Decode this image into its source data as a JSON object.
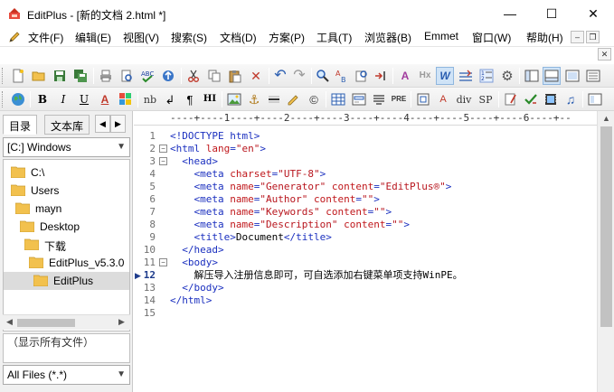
{
  "window": {
    "title": "EditPlus - [新的文档 2.html *]",
    "controls": {
      "minimize": "—",
      "maximize": "☐",
      "close": "✕"
    }
  },
  "menu": {
    "items": [
      "文件(F)",
      "编辑(E)",
      "视图(V)",
      "搜索(S)",
      "文档(D)",
      "方案(P)",
      "工具(T)",
      "浏览器(B)",
      "Emmet",
      "窗口(W)",
      "帮助(H)"
    ],
    "mdi": {
      "minimize": "–",
      "restore": "❐",
      "close": "✕"
    }
  },
  "toolbar2_labels": {
    "bold": "B",
    "italic": "I",
    "underline": "U",
    "font_color": "A",
    "nb": "nb",
    "br": "↲",
    "para": "¶",
    "hi": "HI",
    "pre": "PRE",
    "div": "div",
    "sp": "SP",
    "font_size": "A",
    "hx": "Hx",
    "w": "W",
    "abc": "abc"
  },
  "sidebar": {
    "tabs": [
      "目录",
      "文本库"
    ],
    "drive": "[C:] Windows",
    "folders": [
      {
        "label": "C:\\",
        "indent": 1,
        "selected": false
      },
      {
        "label": "Users",
        "indent": 1,
        "selected": false
      },
      {
        "label": "mayn",
        "indent": 2,
        "selected": false
      },
      {
        "label": "Desktop",
        "indent": 3,
        "selected": false
      },
      {
        "label": "下载",
        "indent": 4,
        "selected": false
      },
      {
        "label": "EditPlus_v5.3.0",
        "indent": 5,
        "selected": false
      },
      {
        "label": "EditPlus",
        "indent": 6,
        "selected": true
      }
    ],
    "file_list_text": "（显示所有文件）",
    "filter": "All Files (*.*)"
  },
  "editor": {
    "ruler": "----+----1----+----2----+----3----+----4----+----5----+----6----+--",
    "current_line": 12,
    "lines": [
      {
        "n": "1",
        "fold": "",
        "parts": [
          [
            "tag",
            "<!DOCTYPE html>"
          ]
        ]
      },
      {
        "n": "2",
        "fold": "⊟",
        "parts": [
          [
            "tag",
            "<html "
          ],
          [
            "attr",
            "lang"
          ],
          [
            "tag",
            "="
          ],
          [
            "str",
            "\"en\""
          ],
          [
            "tag",
            ">"
          ]
        ]
      },
      {
        "n": "3",
        "fold": "⊟",
        "parts": [
          [
            "txt",
            "  "
          ],
          [
            "tag",
            "<head>"
          ]
        ]
      },
      {
        "n": "4",
        "fold": "",
        "parts": [
          [
            "txt",
            "    "
          ],
          [
            "tag",
            "<meta "
          ],
          [
            "attr",
            "charset"
          ],
          [
            "tag",
            "="
          ],
          [
            "str",
            "\"UTF-8\""
          ],
          [
            "tag",
            ">"
          ]
        ]
      },
      {
        "n": "5",
        "fold": "",
        "parts": [
          [
            "txt",
            "    "
          ],
          [
            "tag",
            "<meta "
          ],
          [
            "attr",
            "name"
          ],
          [
            "tag",
            "="
          ],
          [
            "str",
            "\"Generator\""
          ],
          [
            "tag",
            " "
          ],
          [
            "attr",
            "content"
          ],
          [
            "tag",
            "="
          ],
          [
            "str",
            "\"EditPlus®\""
          ],
          [
            "tag",
            ">"
          ]
        ]
      },
      {
        "n": "6",
        "fold": "",
        "parts": [
          [
            "txt",
            "    "
          ],
          [
            "tag",
            "<meta "
          ],
          [
            "attr",
            "name"
          ],
          [
            "tag",
            "="
          ],
          [
            "str",
            "\"Author\""
          ],
          [
            "tag",
            " "
          ],
          [
            "attr",
            "content"
          ],
          [
            "tag",
            "="
          ],
          [
            "str",
            "\"\""
          ],
          [
            "tag",
            ">"
          ]
        ]
      },
      {
        "n": "7",
        "fold": "",
        "parts": [
          [
            "txt",
            "    "
          ],
          [
            "tag",
            "<meta "
          ],
          [
            "attr",
            "name"
          ],
          [
            "tag",
            "="
          ],
          [
            "str",
            "\"Keywords\""
          ],
          [
            "tag",
            " "
          ],
          [
            "attr",
            "content"
          ],
          [
            "tag",
            "="
          ],
          [
            "str",
            "\"\""
          ],
          [
            "tag",
            ">"
          ]
        ]
      },
      {
        "n": "8",
        "fold": "",
        "parts": [
          [
            "txt",
            "    "
          ],
          [
            "tag",
            "<meta "
          ],
          [
            "attr",
            "name"
          ],
          [
            "tag",
            "="
          ],
          [
            "str",
            "\"Description\""
          ],
          [
            "tag",
            " "
          ],
          [
            "attr",
            "content"
          ],
          [
            "tag",
            "="
          ],
          [
            "str",
            "\"\""
          ],
          [
            "tag",
            ">"
          ]
        ]
      },
      {
        "n": "9",
        "fold": "",
        "parts": [
          [
            "txt",
            "    "
          ],
          [
            "tag",
            "<title>"
          ],
          [
            "txt",
            "Document"
          ],
          [
            "tag",
            "</title>"
          ]
        ]
      },
      {
        "n": "10",
        "fold": "",
        "parts": [
          [
            "txt",
            "  "
          ],
          [
            "tag",
            "</head>"
          ]
        ]
      },
      {
        "n": "11",
        "fold": "⊟",
        "parts": [
          [
            "txt",
            "  "
          ],
          [
            "tag",
            "<body>"
          ]
        ]
      },
      {
        "n": "12",
        "fold": "",
        "parts": [
          [
            "txt",
            "    解压导入注册信息即可，可自选添加右键菜单项支持WinPE。"
          ]
        ]
      },
      {
        "n": "13",
        "fold": "",
        "parts": [
          [
            "txt",
            "  "
          ],
          [
            "tag",
            "</body>"
          ]
        ]
      },
      {
        "n": "14",
        "fold": "",
        "parts": [
          [
            "tag",
            "</html>"
          ]
        ]
      },
      {
        "n": "15",
        "fold": "",
        "parts": []
      }
    ]
  }
}
